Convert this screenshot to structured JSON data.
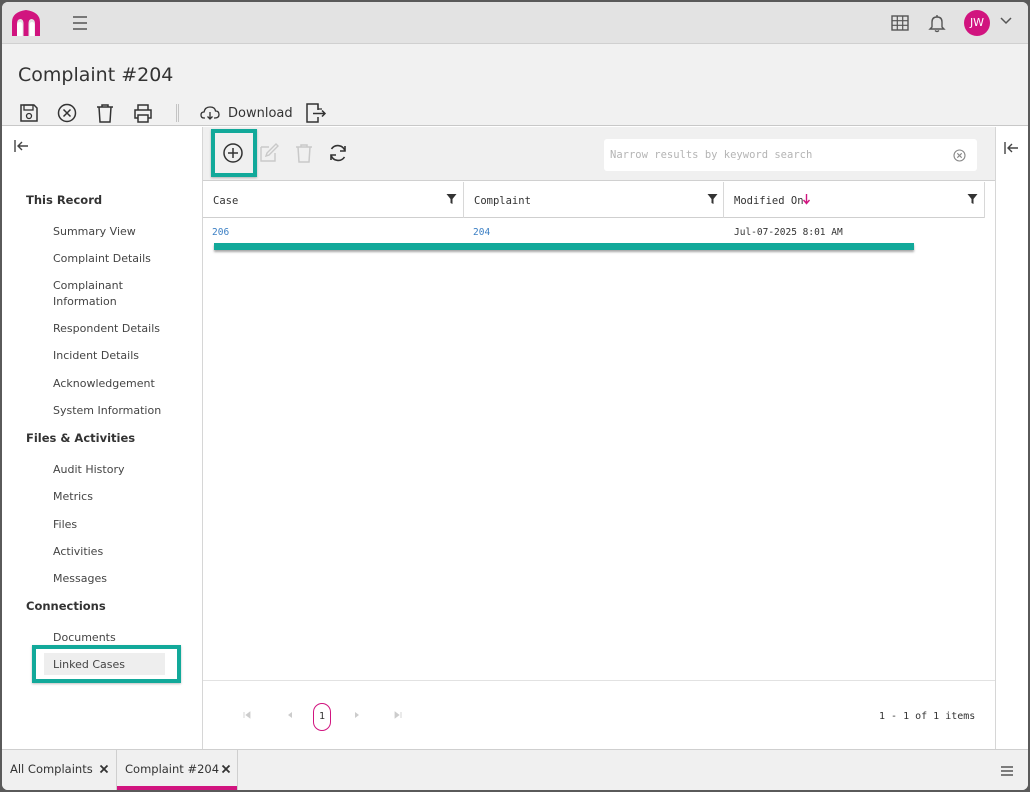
{
  "app": {
    "user_initials": "JW",
    "accent_color": "#d1147f",
    "highlight_color": "#12a99a"
  },
  "header": {
    "title": "Complaint #204",
    "toolbar": {
      "icons": [
        "save-icon",
        "cancel-icon",
        "delete-icon",
        "print-icon",
        "cloud-download-icon",
        "export-icon"
      ],
      "download_label": "Download"
    }
  },
  "sidebar": {
    "sections": [
      {
        "title": "This Record",
        "items": [
          "Summary View",
          "Complaint Details",
          "Complainant Information",
          "Respondent Details",
          "Incident Details",
          "Acknowledgement",
          "System Information"
        ]
      },
      {
        "title": "Files & Activities",
        "items": [
          "Audit History",
          "Metrics",
          "Files",
          "Activities",
          "Messages"
        ]
      },
      {
        "title": "Connections",
        "items": [
          "Documents",
          "Linked Cases"
        ]
      }
    ],
    "active_item": "Linked Cases"
  },
  "grid": {
    "toolbar_icons": [
      "add-icon",
      "edit-icon",
      "delete-icon",
      "refresh-icon"
    ],
    "search_placeholder": "Narrow results by keyword search",
    "columns": [
      "Case",
      "Complaint",
      "Modified On"
    ],
    "sorted_column": "Modified On",
    "sort_direction": "descending",
    "rows": [
      {
        "case": "206",
        "complaint": "204",
        "modified_on": "Jul-07-2025 8:01 AM"
      }
    ],
    "pager": {
      "current_page": "1",
      "info": "1 - 1 of 1 items"
    }
  },
  "bottom_tabs": [
    {
      "label": "All Complaints",
      "active": false
    },
    {
      "label": "Complaint #204",
      "active": true
    }
  ]
}
